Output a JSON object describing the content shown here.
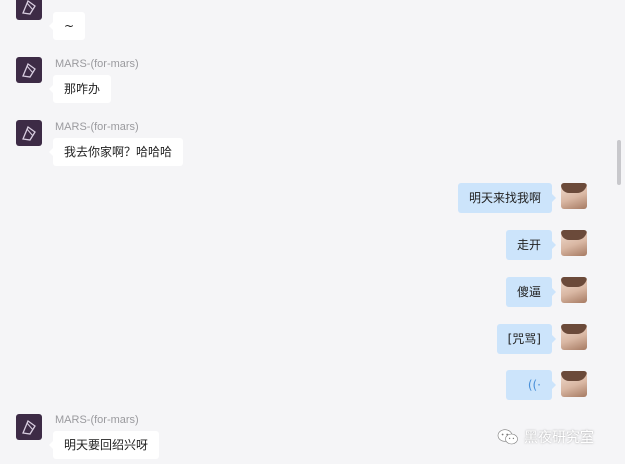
{
  "messages": [
    {
      "side": "left",
      "sender": "",
      "text": "~"
    },
    {
      "side": "left",
      "sender": "MARS-(for-mars)",
      "text": "那咋办"
    },
    {
      "side": "left",
      "sender": "MARS-(for-mars)",
      "text": "我去你家啊？哈哈哈"
    },
    {
      "side": "right",
      "text": "明天来找我啊"
    },
    {
      "side": "right",
      "text": "走开"
    },
    {
      "side": "right",
      "text": "傻逼"
    },
    {
      "side": "right",
      "text": "[咒骂]"
    },
    {
      "side": "right",
      "text": "((·",
      "type": "voice"
    },
    {
      "side": "left",
      "sender": "MARS-(for-mars)",
      "text": "明天要回绍兴呀"
    }
  ],
  "watermark": {
    "text": "黑夜研究室"
  },
  "colors": {
    "background": "#f5f5f7",
    "left_bubble": "#ffffff",
    "right_bubble": "#cce4fb",
    "voice_icon": "#4a90d9",
    "sender_text": "#9a9a9e"
  }
}
